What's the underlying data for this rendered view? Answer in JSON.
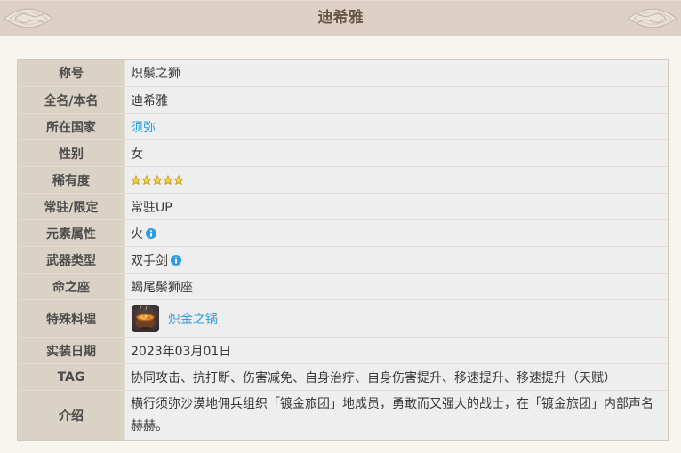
{
  "header": {
    "title": "迪希雅"
  },
  "info": {
    "epithet": {
      "label": "称号",
      "value": "炽鬃之狮"
    },
    "full_name": {
      "label": "全名/本名",
      "value": "迪希雅"
    },
    "nation": {
      "label": "所在国家",
      "value": "须弥"
    },
    "gender": {
      "label": "性别",
      "value": "女"
    },
    "rarity": {
      "label": "稀有度",
      "stars": 5
    },
    "availability": {
      "label": "常驻/限定",
      "value": "常驻UP"
    },
    "element": {
      "label": "元素属性",
      "value": "火",
      "icon": "info-icon"
    },
    "weapon": {
      "label": "武器类型",
      "value": "双手剑",
      "icon": "info-icon"
    },
    "constellation": {
      "label": "命之座",
      "value": "蝎尾鬃狮座"
    },
    "special_dish": {
      "label": "特殊料理",
      "value": "炽金之锅",
      "icon": "dish-pot-icon"
    },
    "release_date": {
      "label": "实装日期",
      "value": "2023年03月01日"
    },
    "tags": {
      "label": "TAG",
      "value": "协同攻击、抗打断、伤害减免、自身治疗、自身伤害提升、移速提升、移速提升（天赋）"
    },
    "intro": {
      "label": "介绍",
      "value": "横行须弥沙漠地佣兵组织「镀金旅团」地成员，勇敢而又强大的战士，在「镀金旅团」内部声名赫赫。"
    }
  },
  "colors": {
    "banner_bg": "#dcd1c4",
    "title_text": "#6a5645",
    "label_bg": "#dbd2c6",
    "value_bg": "#eeeeee",
    "link": "#2a9fe5",
    "star": "#f3d04a",
    "info_icon": "#2e9be2"
  }
}
